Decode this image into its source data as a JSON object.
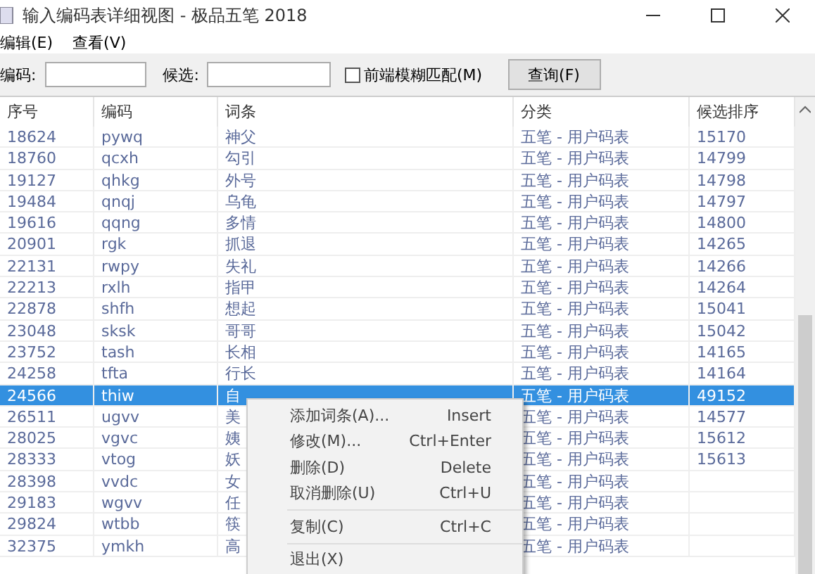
{
  "window": {
    "title": "输入编码表详细视图 - 极品五笔 2018"
  },
  "menu_bar": [
    "编辑(E)",
    "查看(V)"
  ],
  "search": {
    "code_label": "编码:",
    "candidate_label": "候选:",
    "fuzzy_match": {
      "label": "前端模糊匹配(M)",
      "checked": false
    },
    "query_button": "查询(F)"
  },
  "table": {
    "columns": [
      "序号",
      "编码",
      "词条",
      "分类",
      "候选排序"
    ],
    "rows": [
      {
        "cells": [
          "18624",
          "pywq",
          "神父",
          "五笔 - 用户码表",
          "15170"
        ],
        "selected": false
      },
      {
        "cells": [
          "18760",
          "qcxh",
          "勾引",
          "五笔 - 用户码表",
          "14799"
        ],
        "selected": false
      },
      {
        "cells": [
          "19127",
          "qhkg",
          "外号",
          "五笔 - 用户码表",
          "14798"
        ],
        "selected": false
      },
      {
        "cells": [
          "19484",
          "qnqj",
          "乌龟",
          "五笔 - 用户码表",
          "14797"
        ],
        "selected": false
      },
      {
        "cells": [
          "19616",
          "qqng",
          "多情",
          "五笔 - 用户码表",
          "14800"
        ],
        "selected": false
      },
      {
        "cells": [
          "20901",
          "rgk",
          "抓退",
          "五笔 - 用户码表",
          "14265"
        ],
        "selected": false
      },
      {
        "cells": [
          "22131",
          "rwpy",
          "失礼",
          "五笔 - 用户码表",
          "14266"
        ],
        "selected": false
      },
      {
        "cells": [
          "22213",
          "rxlh",
          "指甲",
          "五笔 - 用户码表",
          "14264"
        ],
        "selected": false
      },
      {
        "cells": [
          "22878",
          "shfh",
          "想起",
          "五笔 - 用户码表",
          "15041"
        ],
        "selected": false
      },
      {
        "cells": [
          "23048",
          "sksk",
          "哥哥",
          "五笔 - 用户码表",
          "15042"
        ],
        "selected": false
      },
      {
        "cells": [
          "23752",
          "tash",
          "长相",
          "五笔 - 用户码表",
          "14165"
        ],
        "selected": false
      },
      {
        "cells": [
          "24258",
          "tfta",
          "行长",
          "五笔 - 用户码表",
          "14164"
        ],
        "selected": false
      },
      {
        "cells": [
          "24566",
          "thiw",
          "自",
          "五笔 - 用户码表",
          "49152"
        ],
        "selected": true
      },
      {
        "cells": [
          "26511",
          "ugvv",
          "美",
          "五笔 - 用户码表",
          "14577"
        ],
        "selected": false
      },
      {
        "cells": [
          "28025",
          "vgvc",
          "姨",
          "五笔 - 用户码表",
          "15612"
        ],
        "selected": false
      },
      {
        "cells": [
          "28333",
          "vtog",
          "妖",
          "五笔 - 用户码表",
          "15613"
        ],
        "selected": false
      },
      {
        "cells": [
          "28398",
          "vvdc",
          "女",
          "五笔 - 用户码表"
        ],
        "selected": false
      },
      {
        "cells": [
          "29183",
          "wgvv",
          "任",
          "五笔 - 用户码表"
        ],
        "selected": false
      },
      {
        "cells": [
          "29824",
          "wtbb",
          "筷",
          "五笔 - 用户码表"
        ],
        "selected": false
      },
      {
        "cells": [
          "32375",
          "ymkh",
          "高",
          "五笔 - 用户码表"
        ],
        "selected": false
      }
    ]
  },
  "context_menu": {
    "items": [
      {
        "kind": "item",
        "label": "添加词条(A)...",
        "shortcut": "Insert"
      },
      {
        "kind": "item",
        "label": "修改(M)...",
        "shortcut": "Ctrl+Enter"
      },
      {
        "kind": "item",
        "label": "删除(D)",
        "shortcut": "Delete"
      },
      {
        "kind": "item",
        "label": "取消删除(U)",
        "shortcut": "Ctrl+U"
      },
      {
        "kind": "separator"
      },
      {
        "kind": "item",
        "label": "复制(C)",
        "shortcut": "Ctrl+C"
      },
      {
        "kind": "separator"
      },
      {
        "kind": "item",
        "label": "退出(X)"
      }
    ]
  }
}
